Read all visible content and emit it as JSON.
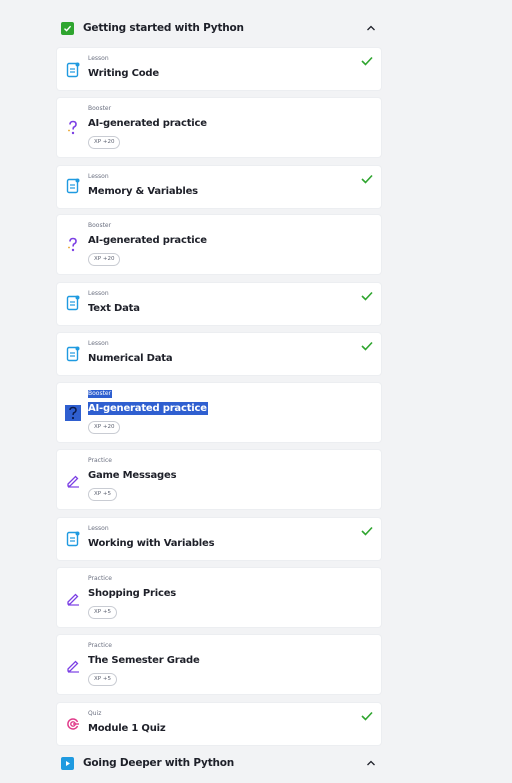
{
  "sections": [
    {
      "title": "Getting started with Python",
      "icon": "checkbox-checked-icon",
      "color": "#2fa52f"
    },
    {
      "title": "Going Deeper with Python",
      "icon": "play-icon",
      "color": "#1f9ae0"
    }
  ],
  "items": [
    {
      "kind": "Lesson",
      "title": "Writing Code",
      "xp": "",
      "completed": true,
      "icon": "lesson-icon"
    },
    {
      "kind": "Booster",
      "title": "AI-generated practice",
      "xp": "XP +20",
      "completed": false,
      "icon": "question-icon"
    },
    {
      "kind": "Lesson",
      "title": "Memory & Variables",
      "xp": "",
      "completed": true,
      "icon": "lesson-icon"
    },
    {
      "kind": "Booster",
      "title": "AI-generated practice",
      "xp": "XP +20",
      "completed": false,
      "icon": "question-icon"
    },
    {
      "kind": "Lesson",
      "title": "Text Data",
      "xp": "",
      "completed": true,
      "icon": "lesson-icon"
    },
    {
      "kind": "Lesson",
      "title": "Numerical Data",
      "xp": "",
      "completed": true,
      "icon": "lesson-icon"
    },
    {
      "kind": "Booster",
      "title": "AI-generated practice",
      "xp": "XP +20",
      "completed": false,
      "icon": "question-icon",
      "selected": true
    },
    {
      "kind": "Practice",
      "title": "Game Messages",
      "xp": "XP +5",
      "completed": false,
      "icon": "practice-icon"
    },
    {
      "kind": "Lesson",
      "title": "Working with Variables",
      "xp": "",
      "completed": true,
      "icon": "lesson-icon"
    },
    {
      "kind": "Practice",
      "title": "Shopping Prices",
      "xp": "XP +5",
      "completed": false,
      "icon": "practice-icon"
    },
    {
      "kind": "Practice",
      "title": "The Semester Grade",
      "xp": "XP +5",
      "completed": false,
      "icon": "practice-icon"
    },
    {
      "kind": "Quiz",
      "title": "Module 1 Quiz",
      "xp": "",
      "completed": true,
      "icon": "quiz-icon"
    }
  ],
  "colors": {
    "check": "#2fa52f",
    "lesson": "#1f9ae0",
    "booster": "#7b3fe4",
    "practice": "#7b3fe4",
    "quiz": "#e03a8a",
    "selection": "#2f5fd0"
  }
}
